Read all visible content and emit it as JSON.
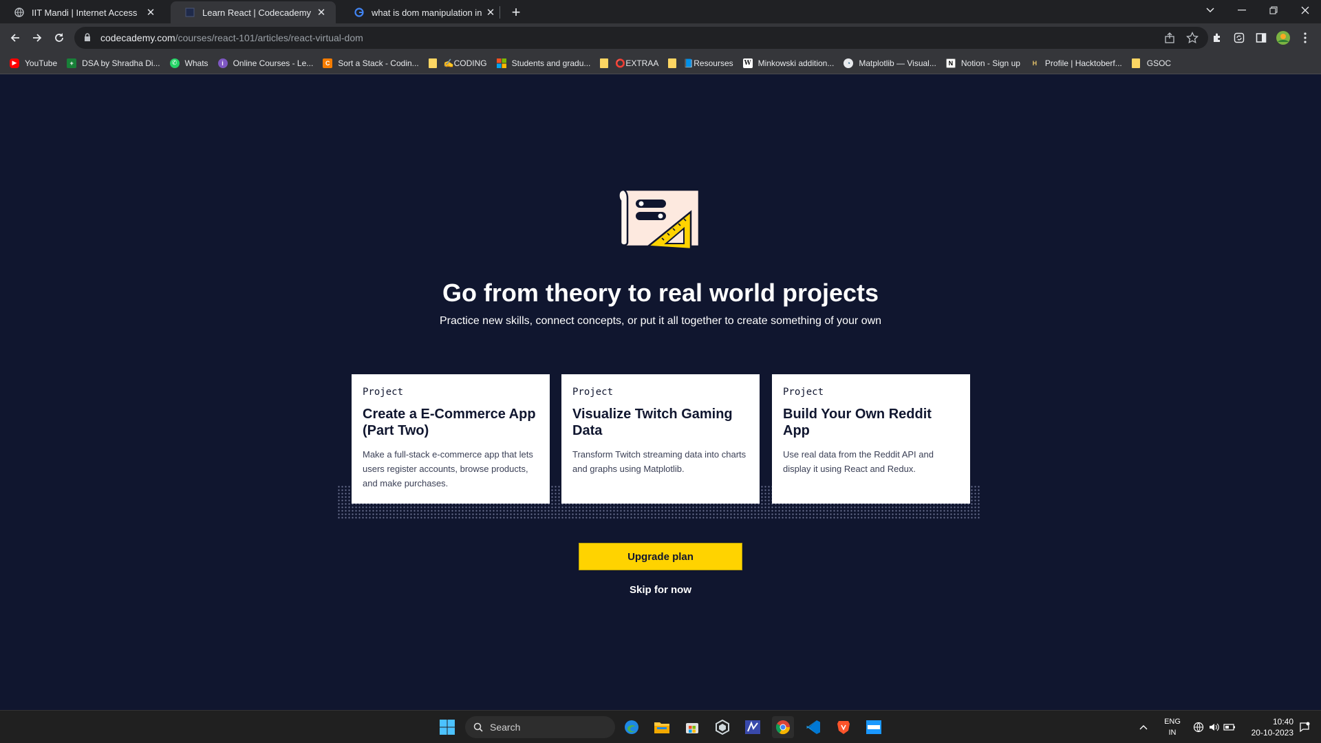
{
  "browser": {
    "tabs": [
      {
        "title": "IIT Mandi | Internet Access",
        "active": false
      },
      {
        "title": "Learn React | Codecademy",
        "active": true
      },
      {
        "title": "what is dom manipulation in rea",
        "active": false
      }
    ],
    "url": {
      "host": "codecademy.com",
      "path": "/courses/react-101/articles/react-virtual-dom"
    },
    "bookmarks": [
      {
        "label": "YouTube",
        "icon": "youtube-icon"
      },
      {
        "label": "DSA by Shradha Di...",
        "icon": "plus-icon"
      },
      {
        "label": "Whats",
        "icon": "whatsapp-icon"
      },
      {
        "label": "Online Courses - Le...",
        "icon": "course-icon"
      },
      {
        "label": "Sort a Stack - Codin...",
        "icon": "codingninja-icon"
      },
      {
        "label": "✍️CODING",
        "icon": "folder-icon"
      },
      {
        "label": "Students and gradu...",
        "icon": "microsoft-icon"
      },
      {
        "label": "⭕EXTRAA",
        "icon": "folder-icon"
      },
      {
        "label": "📘Resourses",
        "icon": "folder-icon"
      },
      {
        "label": "Minkowski addition...",
        "icon": "wikipedia-icon"
      },
      {
        "label": "Matplotlib — Visual...",
        "icon": "matplotlib-icon"
      },
      {
        "label": "Notion - Sign up",
        "icon": "notion-icon"
      },
      {
        "label": "Profile | Hacktoberf...",
        "icon": "hacktoberfest-icon"
      },
      {
        "label": "GSOC",
        "icon": "folder-icon"
      }
    ]
  },
  "page": {
    "headline": "Go from theory to real world projects",
    "subheadline": "Practice new skills, connect concepts, or put it all together to create something of your own",
    "cards": [
      {
        "kind": "Project",
        "title": "Create a E-Commerce App (Part Two)",
        "description": "Make a full-stack e-commerce app that lets users register accounts, browse products, and make purchases."
      },
      {
        "kind": "Project",
        "title": "Visualize Twitch Gaming Data",
        "description": "Transform Twitch streaming data into charts and graphs using Matplotlib."
      },
      {
        "kind": "Project",
        "title": "Build Your Own Reddit App",
        "description": "Use real data from the Reddit API and display it using React and Redux."
      }
    ],
    "upgrade_label": "Upgrade plan",
    "skip_label": "Skip for now",
    "colors": {
      "background": "#10162f",
      "cta": "#ffd300"
    }
  },
  "taskbar": {
    "search_label": "Search",
    "lang_line1": "ENG",
    "lang_line2": "IN",
    "time": "10:40",
    "date": "20-10-2023"
  }
}
